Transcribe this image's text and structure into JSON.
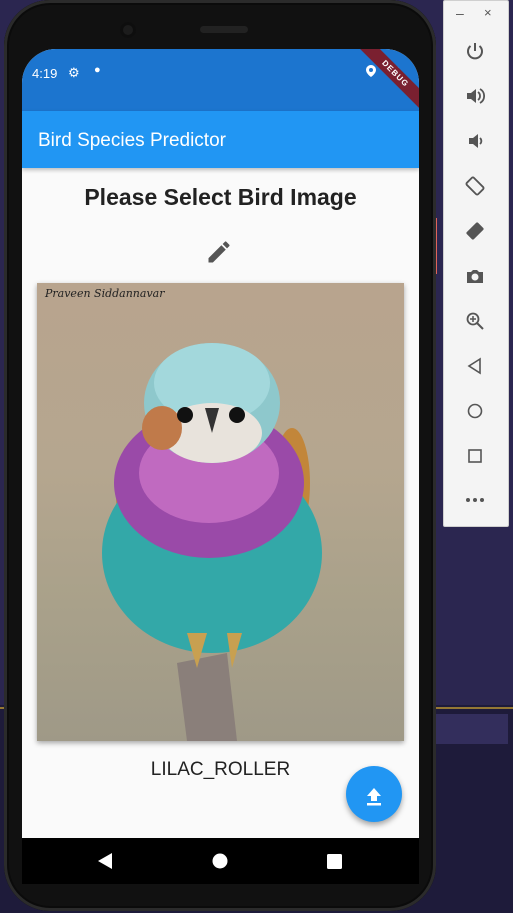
{
  "status_bar": {
    "time": "4:19",
    "debug_label": "DEBUG"
  },
  "app_bar": {
    "title": "Bird Species Predictor"
  },
  "main": {
    "heading": "Please Select Bird Image",
    "photo_watermark": "Praveen Siddannavar",
    "prediction": "LILAC_ROLLER"
  },
  "emulator": {
    "minimize": "–",
    "close": "×"
  },
  "colors": {
    "appbar": "#2196f3",
    "statusbar": "#1c75cf",
    "fab": "#2196f3"
  }
}
